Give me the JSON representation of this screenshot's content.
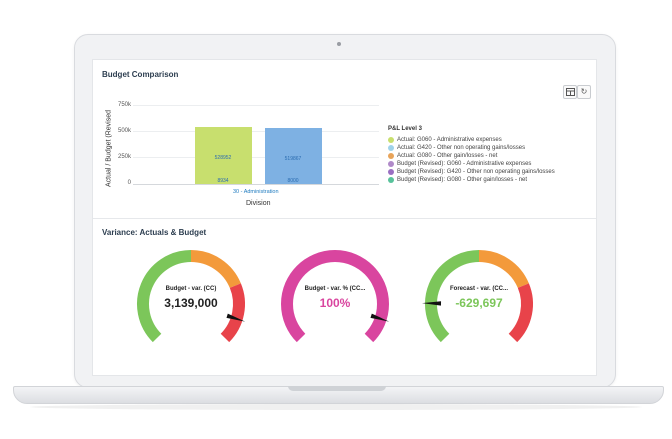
{
  "budget_comparison": {
    "title": "Budget Comparison",
    "toolbar": {
      "table_icon": "table-icon",
      "refresh_icon": "refresh-icon"
    },
    "chart_data": {
      "type": "bar",
      "ylabel": "Actual / Budget (Revised",
      "xlabel": "Division",
      "ylim": [
        0,
        750000
      ],
      "yticks": [
        "750k",
        "500k",
        "250k",
        "0"
      ],
      "categories": [
        "30 - Administration"
      ],
      "series": [
        {
          "name": "Actual: G060 - Administrative expenses",
          "values": [
            528952
          ],
          "label": "528952",
          "color": "#c8df6e"
        },
        {
          "name": "Actual: G420 - Other non operating gains/losses",
          "values": [
            8934
          ],
          "label": "8934",
          "color": "#c8df6e"
        },
        {
          "name": "Actual: G080 - Other gain/losses - net",
          "values": [
            0
          ],
          "label": "",
          "color": "#c8df6e"
        },
        {
          "name": "Budget (Revised): G060 - Administrative expenses",
          "values": [
            519867
          ],
          "label": "519867",
          "color": "#7eb1e3"
        },
        {
          "name": "Budget (Revised): G420 - Other non operating gains/losses",
          "values": [
            8000
          ],
          "label": "8000",
          "color": "#7eb1e3"
        },
        {
          "name": "Budget (Revised): G080 - Other gain/losses - net",
          "values": [
            0
          ],
          "label": "",
          "color": "#7eb1e3"
        }
      ],
      "grid": true,
      "legend": {
        "title": "P&L Level 3",
        "placement": "right",
        "items": [
          {
            "label": "Actual: G060 - Administrative expenses",
            "color": "#c8df6e"
          },
          {
            "label": "Actual: G420 - Other non operating gains/losses",
            "color": "#9fd3ea"
          },
          {
            "label": "Actual: G080 - Other gain/losses - net",
            "color": "#e8a45a"
          },
          {
            "label": "Budget (Revised): G060 - Administrative expenses",
            "color": "#b08ac9"
          },
          {
            "label": "Budget (Revised): G420 - Other non operating gains/losses",
            "color": "#9a6fc2"
          },
          {
            "label": "Budget (Revised): G080 - Other gain/losses - net",
            "color": "#58c29b"
          }
        ]
      }
    }
  },
  "variance": {
    "title": "Variance: Actuals & Budget",
    "gauges": [
      {
        "title": "Budget - var. (CC)",
        "value": "3,139,000",
        "value_color": "#222222",
        "style": "tricolor",
        "pointer": 0.9
      },
      {
        "title": "Budget - var. % (CC...",
        "value": "100%",
        "value_color": "#d9459f",
        "style": "pink",
        "pointer": 0.9
      },
      {
        "title": "Forecast - var. (CC...",
        "value": "-629,697",
        "value_color": "#7cc65a",
        "style": "tricolor",
        "pointer": 0.17
      }
    ],
    "colors": {
      "green": "#7cc65a",
      "orange": "#f39a3b",
      "red": "#e8434a",
      "pink": "#d9459f"
    }
  }
}
